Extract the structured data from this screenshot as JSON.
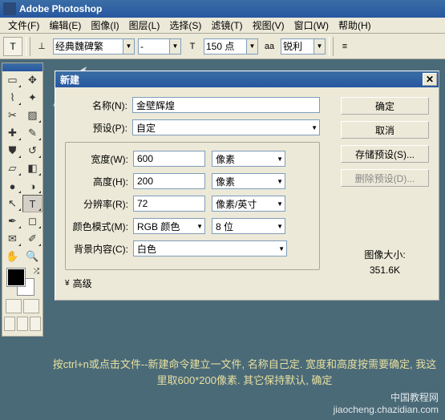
{
  "titlebar": {
    "app_name": "Adobe Photoshop"
  },
  "menu": {
    "file": "文件(F)",
    "edit": "编辑(E)",
    "image": "图像(I)",
    "layer": "图层(L)",
    "select": "选择(S)",
    "filter": "滤镜(T)",
    "view": "视图(V)",
    "window": "窗口(W)",
    "help": "帮助(H)"
  },
  "options": {
    "font_family": "经典魏碑繁",
    "font_style": "-",
    "font_size": "150 点",
    "aa_label": "aa",
    "aa_value": "锐利"
  },
  "dialog": {
    "title": "新建",
    "name_label": "名称(N):",
    "name_value": "金壁辉煌",
    "preset_label": "预设(P):",
    "preset_value": "自定",
    "width_label": "宽度(W):",
    "width_value": "600",
    "width_unit": "像素",
    "height_label": "高度(H):",
    "height_value": "200",
    "height_unit": "像素",
    "res_label": "分辨率(R):",
    "res_value": "72",
    "res_unit": "像素/英寸",
    "mode_label": "颜色模式(M):",
    "mode_value": "RGB 颜色",
    "mode_depth": "8 位",
    "bg_label": "背景内容(C):",
    "bg_value": "白色",
    "advanced": "高级",
    "size_label": "图像大小:",
    "size_value": "351.6K",
    "buttons": {
      "ok": "确定",
      "cancel": "取消",
      "save_preset": "存储预设(S)...",
      "delete_preset": "删除预设(D)..."
    }
  },
  "instruction": "按ctrl+n或点击文件--新建命令建立一文件, 名称自己定. 宽度和高度按需要确定, 我这里取600*200像素. 其它保持默认, 确定",
  "watermark": {
    "line1": "中国教程网",
    "line2": "jiaocheng.chazidian.com"
  }
}
